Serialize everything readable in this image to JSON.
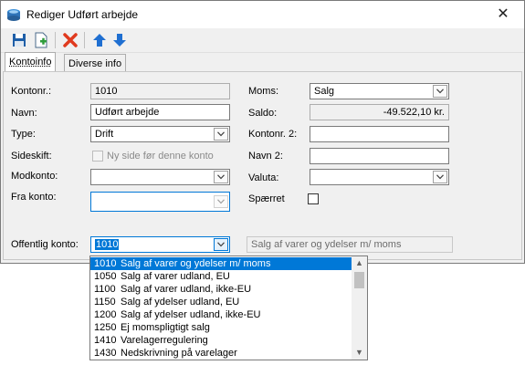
{
  "window": {
    "title": "Rediger Udført arbejde",
    "close_glyph": "✕"
  },
  "toolbar": {
    "icons": [
      "save-icon",
      "save-new-icon",
      "delete-icon",
      "arrow-up-icon",
      "arrow-down-icon"
    ]
  },
  "tabs": [
    {
      "label": "Kontoinfo",
      "active": true
    },
    {
      "label": "Diverse info",
      "active": false
    }
  ],
  "form": {
    "kontonr_label": "Kontonr.:",
    "kontonr_value": "1010",
    "navn_label": "Navn:",
    "navn_value": "Udført arbejde",
    "type_label": "Type:",
    "type_value": "Drift",
    "sideskift_label": "Sideskift:",
    "sideskift_checkbox_label": "Ny side før denne konto",
    "modkonto_label": "Modkonto:",
    "modkonto_value": "",
    "frakonto_label": "Fra konto:",
    "frakonto_value": "",
    "moms_label": "Moms:",
    "moms_value": "Salg",
    "saldo_label": "Saldo:",
    "saldo_value": "-49.522,10 kr.",
    "kontonr2_label": "Kontonr. 2:",
    "kontonr2_value": "",
    "navn2_label": "Navn 2:",
    "navn2_value": "",
    "valuta_label": "Valuta:",
    "valuta_value": "",
    "spaerret_label": "Spærret",
    "offentlig_label": "Offentlig konto:",
    "offentlig_value": "1010",
    "offentlig_desc_placeholder": "Salg af varer og ydelser m/ moms"
  },
  "dropdown": {
    "items": [
      {
        "code": "1010",
        "text": "Salg af varer og ydelser m/ moms"
      },
      {
        "code": "1050",
        "text": "Salg af varer udland, EU"
      },
      {
        "code": "1100",
        "text": "Salg af varer udland, ikke-EU"
      },
      {
        "code": "1150",
        "text": "Salg af ydelser udland, EU"
      },
      {
        "code": "1200",
        "text": "Salg af ydelser udland, ikke-EU"
      },
      {
        "code": "1250",
        "text": "Ej momspligtigt salg"
      },
      {
        "code": "1410",
        "text": "Varelagerregulering"
      },
      {
        "code": "1430",
        "text": "Nedskrivning på varelager"
      }
    ],
    "selected_index": 0
  },
  "colors": {
    "selection": "#0078d7",
    "window_bg": "#f0f0f0",
    "delete_red": "#e03a1e",
    "arrow_blue": "#1f6fd1"
  }
}
